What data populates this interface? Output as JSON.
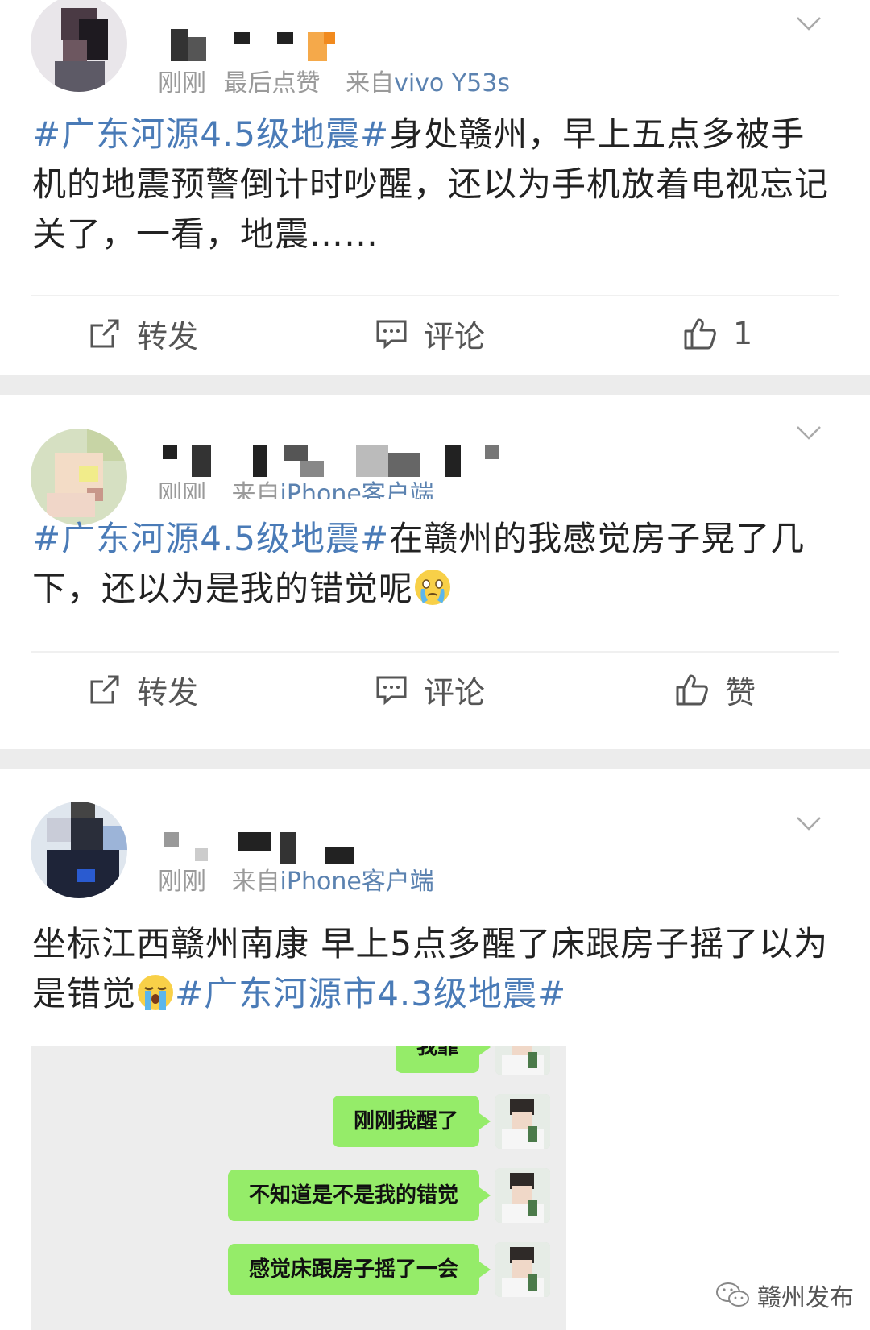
{
  "posts": [
    {
      "time": "刚刚",
      "extra": "最后点赞",
      "source_prefix": "来自",
      "device": "vivo Y53s",
      "hashtag": "#广东河源4.5级地震#",
      "text": "身处赣州，早上五点多被手机的地震预警倒计时吵醒，还以为手机放着电视忘记关了，一看，地震……",
      "repost_label": "转发",
      "comment_label": "评论",
      "like_label": "1"
    },
    {
      "time": "刚刚",
      "source_prefix": "来自",
      "device": "iPhone客户端",
      "hashtag": "#广东河源4.5级地震#",
      "text": "在赣州的我感觉房子晃了几下，还以为是我的错觉呢",
      "repost_label": "转发",
      "comment_label": "评论",
      "like_label": "赞"
    },
    {
      "time": "刚刚",
      "source_prefix": "来自",
      "device": "iPhone客户端",
      "text": "坐标江西赣州南康 早上5点多醒了床跟房子摇了以为是错觉",
      "hashtag": "#广东河源市4.3级地震#",
      "chat_messages": [
        "刚刚我醒了",
        "不知道是不是我的错觉",
        "感觉床跟房子摇了一会"
      ],
      "chat_partial": "我靠"
    }
  ],
  "watermark": "赣州发布",
  "colors": {
    "link": "#4a7bb7",
    "bubble": "#95ec69",
    "separator": "#ececec",
    "meta": "#9a9a9a"
  }
}
